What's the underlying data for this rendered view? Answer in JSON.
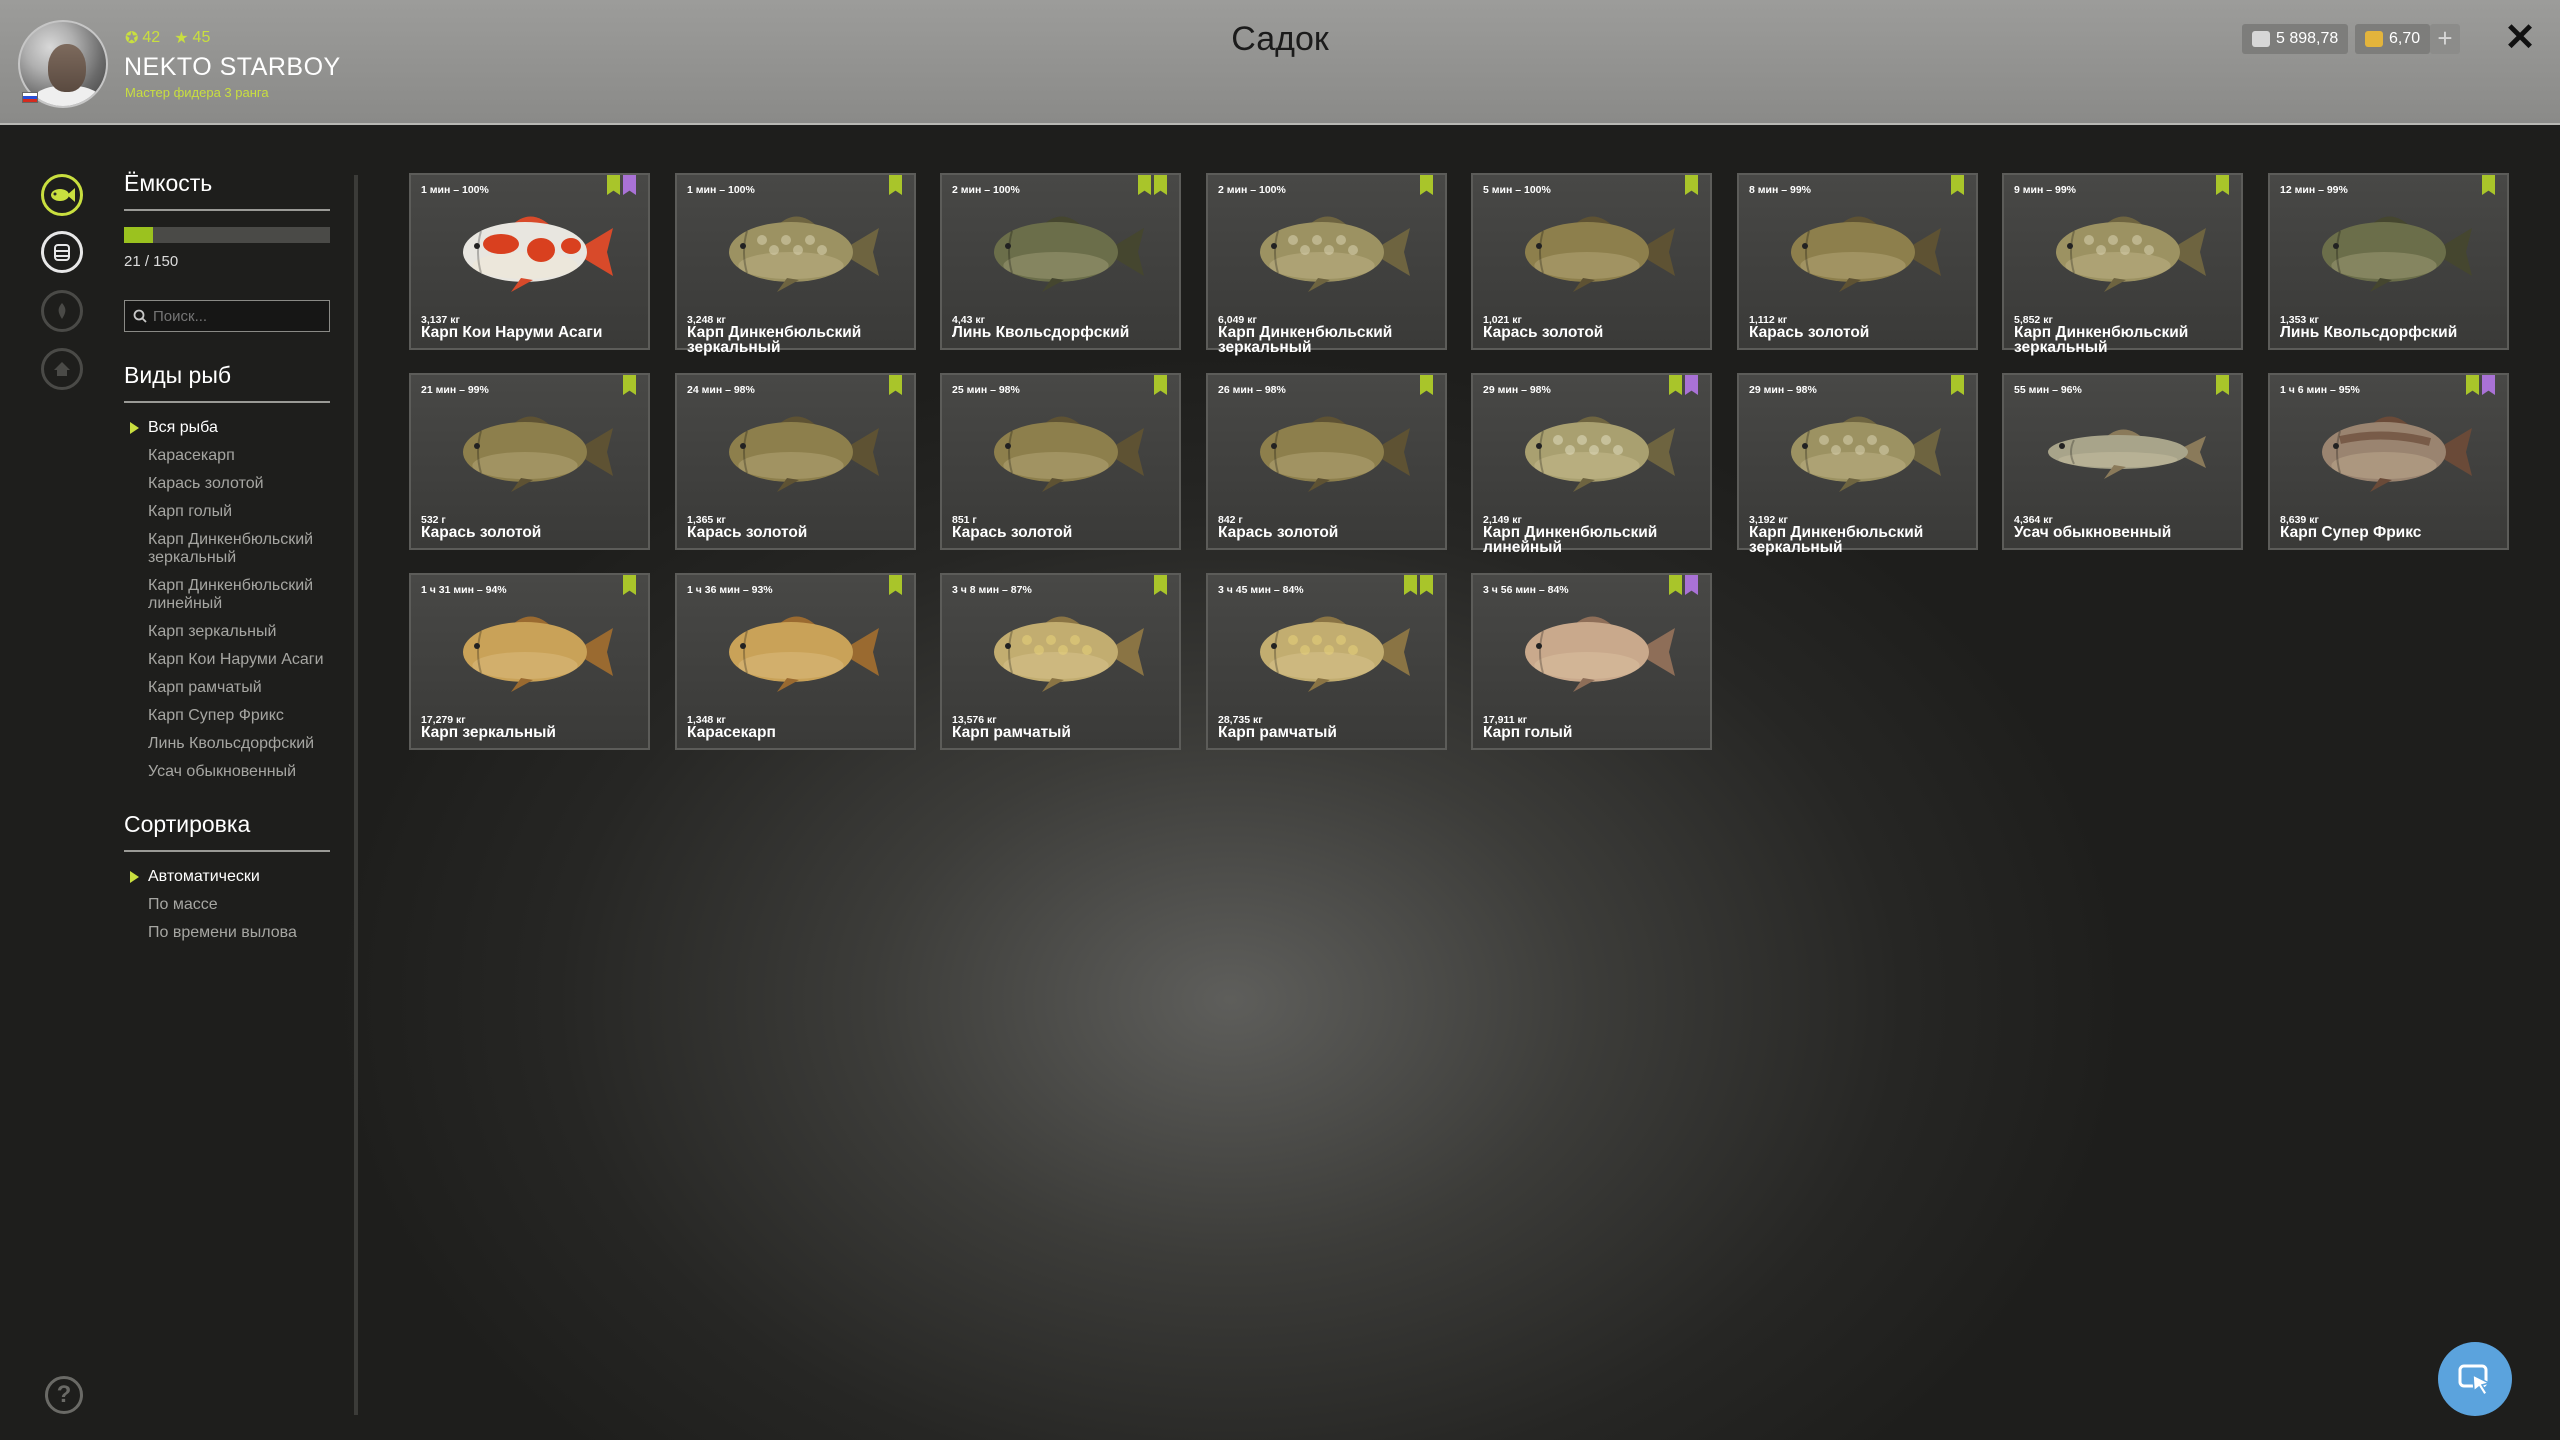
{
  "header": {
    "title": "Садок",
    "player": {
      "name": "NEKTO STARBOY",
      "rank": "Мастер фидера 3 ранга",
      "level": "42",
      "stars": "45"
    },
    "silver": "5 898,78",
    "gold": "6,70",
    "plus_label": "+",
    "close_label": "✕"
  },
  "sidebar": {
    "capacity_title": "Ёмкость",
    "capacity_text": "21 / 150",
    "capacity_fraction": 0.14,
    "search_placeholder": "Поиск...",
    "species_title": "Виды рыб",
    "species": [
      "Вся рыба",
      "Карасекарп",
      "Карась золотой",
      "Карп голый",
      "Карп Динкенбюльский зеркальный",
      "Карп Динкенбюльский линейный",
      "Карп зеркальный",
      "Карп Кои Наруми Асаги",
      "Карп рамчатый",
      "Карп Супер Фрикс",
      "Линь Кволь­сдорфский",
      "Усач обыкновенный"
    ],
    "sort_title": "Сортировка",
    "sort_options": [
      "Автоматически",
      "По массе",
      "По времени вылова"
    ]
  },
  "accent_color": "#c9df3f",
  "fish": [
    {
      "time": "1 мин – 100%",
      "weight": "3,137 кг",
      "name": "Карп Кои Наруми Асаги",
      "flags": [
        "green",
        "purple"
      ],
      "kind": "koi"
    },
    {
      "time": "1 мин – 100%",
      "weight": "3,248 кг",
      "name": "Карп Динкенбюльский зеркальный",
      "flags": [
        "green"
      ],
      "kind": "mirror"
    },
    {
      "time": "2 мин – 100%",
      "weight": "4,43 кг",
      "name": "Линь Кволь­сдорфский",
      "flags": [
        "green",
        "yellow"
      ],
      "kind": "tench"
    },
    {
      "time": "2 мин – 100%",
      "weight": "6,049 кг",
      "name": "Карп Динкенбюльский зеркальный",
      "flags": [
        "green"
      ],
      "kind": "mirror"
    },
    {
      "time": "5 мин – 100%",
      "weight": "1,021 кг",
      "name": "Карась золотой",
      "flags": [
        "green"
      ],
      "kind": "crucian"
    },
    {
      "time": "8 мин – 99%",
      "weight": "1,112 кг",
      "name": "Карась золотой",
      "flags": [
        "green"
      ],
      "kind": "crucian"
    },
    {
      "time": "9 мин – 99%",
      "weight": "5,852 кг",
      "name": "Карп Динкенбюльский зеркальный",
      "flags": [
        "green"
      ],
      "kind": "mirror"
    },
    {
      "time": "12 мин – 99%",
      "weight": "1,353 кг",
      "name": "Линь Кволь­сдорфский",
      "flags": [
        "green"
      ],
      "kind": "tench"
    },
    {
      "time": "21 мин – 99%",
      "weight": "532 г",
      "name": "Карась золотой",
      "flags": [
        "green"
      ],
      "kind": "crucian"
    },
    {
      "time": "24 мин – 98%",
      "weight": "1,365 кг",
      "name": "Карась золотой",
      "flags": [
        "green"
      ],
      "kind": "crucian"
    },
    {
      "time": "25 мин – 98%",
      "weight": "851 г",
      "name": "Карась золотой",
      "flags": [
        "green"
      ],
      "kind": "crucian"
    },
    {
      "time": "26 мин – 98%",
      "weight": "842 г",
      "name": "Карась золотой",
      "flags": [
        "green"
      ],
      "kind": "crucian"
    },
    {
      "time": "29 мин – 98%",
      "weight": "2,149 кг",
      "name": "Карп Динкенбюльский линейный",
      "flags": [
        "green",
        "purple"
      ],
      "kind": "linear"
    },
    {
      "time": "29 мин – 98%",
      "weight": "3,192 кг",
      "name": "Карп Динкенбюльский зеркальный",
      "flags": [
        "green"
      ],
      "kind": "mirror"
    },
    {
      "time": "55 мин – 96%",
      "weight": "4,364 кг",
      "name": "Усач обыкновенный",
      "flags": [
        "green"
      ],
      "kind": "barbel"
    },
    {
      "time": "1 ч 6 мин – 95%",
      "weight": "8,639 кг",
      "name": "Карп Супер Фрикс",
      "flags": [
        "green",
        "purple"
      ],
      "kind": "frix"
    },
    {
      "time": "1 ч 31 мин – 94%",
      "weight": "17,279 кг",
      "name": "Карп зеркальный",
      "flags": [
        "green"
      ],
      "kind": "golden"
    },
    {
      "time": "1 ч 36 мин – 93%",
      "weight": "1,348 кг",
      "name": "Карасекарп",
      "flags": [
        "green"
      ],
      "kind": "golden"
    },
    {
      "time": "3 ч 8 мин – 87%",
      "weight": "13,576 кг",
      "name": "Карп рамчатый",
      "flags": [
        "green"
      ],
      "kind": "frame"
    },
    {
      "time": "3 ч 45 мин – 84%",
      "weight": "28,735 кг",
      "name": "Карп рамчатый",
      "flags": [
        "green",
        "yellow"
      ],
      "kind": "frame"
    },
    {
      "time": "3 ч 56 мин – 84%",
      "weight": "17,911 кг",
      "name": "Карп голый",
      "flags": [
        "green",
        "purple"
      ],
      "kind": "leather"
    }
  ]
}
